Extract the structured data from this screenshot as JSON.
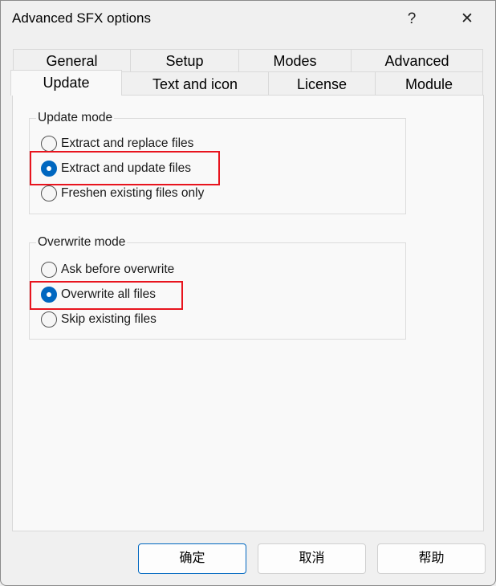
{
  "window": {
    "title": "Advanced SFX options",
    "help_label": "?",
    "close_label": "✕"
  },
  "tabs": {
    "row1": [
      {
        "label": "General"
      },
      {
        "label": "Setup"
      },
      {
        "label": "Modes"
      },
      {
        "label": "Advanced"
      }
    ],
    "row2": [
      {
        "label": "Update",
        "selected": true
      },
      {
        "label": "Text and icon"
      },
      {
        "label": "License"
      },
      {
        "label": "Module"
      }
    ]
  },
  "update_mode": {
    "label": "Update mode",
    "options": [
      {
        "label": "Extract and replace files",
        "checked": false
      },
      {
        "label": "Extract and update files",
        "checked": true
      },
      {
        "label": "Freshen existing files only",
        "checked": false
      }
    ]
  },
  "overwrite_mode": {
    "label": "Overwrite mode",
    "options": [
      {
        "label": "Ask before overwrite",
        "checked": false
      },
      {
        "label": "Overwrite all files",
        "checked": true
      },
      {
        "label": "Skip existing files",
        "checked": false
      }
    ]
  },
  "buttons": {
    "ok": "确定",
    "cancel": "取消",
    "help": "帮助"
  },
  "colors": {
    "accent": "#0067c0",
    "highlight": "#e8141e"
  }
}
